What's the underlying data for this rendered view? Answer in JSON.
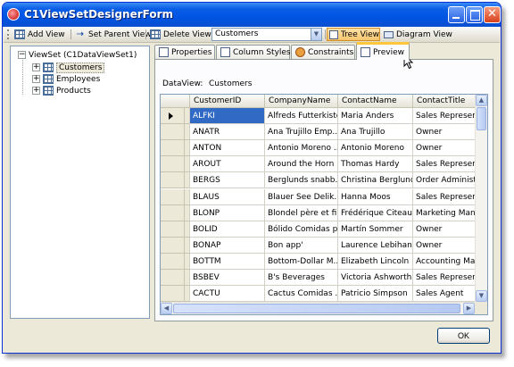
{
  "window": {
    "title": "C1ViewSetDesignerForm"
  },
  "toolbar": {
    "add_view": "Add View",
    "set_parent_view": "Set Parent View",
    "delete_view": "Delete View",
    "view_combo_value": "Customers",
    "tree_view": "Tree View",
    "diagram_view": "Diagram View"
  },
  "tree": {
    "root": "ViewSet (C1DataViewSet1)",
    "children": [
      "Customers",
      "Employees",
      "Products"
    ]
  },
  "tabs": [
    "Properties",
    "Column Styles",
    "Constraints",
    "Preview"
  ],
  "preview": {
    "dataview_label": "DataView:",
    "dataview_value": "Customers",
    "columns": [
      "CustomerID",
      "CompanyName",
      "ContactName",
      "ContactTitle"
    ],
    "rows": [
      [
        "ALFKI",
        "Alfreds Futterkiste",
        "Maria Anders",
        "Sales Represent..."
      ],
      [
        "ANATR",
        "Ana Trujillo Emp...",
        "Ana Trujillo",
        "Owner"
      ],
      [
        "ANTON",
        "Antonio Moreno ...",
        "Antonio Moreno",
        "Owner"
      ],
      [
        "AROUT",
        "Around the Horn",
        "Thomas Hardy",
        "Sales Represent..."
      ],
      [
        "BERGS",
        "Berglunds snabb...",
        "Christina Berglund",
        "Order Administr..."
      ],
      [
        "BLAUS",
        "Blauer See Delik...",
        "Hanna Moos",
        "Sales Represent..."
      ],
      [
        "BLONP",
        "Blondel père et fils",
        "Frédérique Citeaux",
        "Marketing Manage"
      ],
      [
        "BOLID",
        "Bólido Comidas p...",
        "Martín Sommer",
        "Owner"
      ],
      [
        "BONAP",
        "Bon app'",
        "Laurence Lebihan",
        "Owner"
      ],
      [
        "BOTTM",
        "Bottom-Dollar M...",
        "Elizabeth Lincoln",
        "Accounting Man..."
      ],
      [
        "BSBEV",
        "B's Beverages",
        "Victoria Ashworth",
        "Sales Represent..."
      ],
      [
        "CACTU",
        "Cactus Comidas ...",
        "Patricio Simpson",
        "Sales Agent"
      ]
    ]
  },
  "footer": {
    "ok": "OK"
  },
  "colors": {
    "titlebar": "#0054e3",
    "selection": "#316ac5",
    "active_tab_accent": "#ffc83c"
  }
}
